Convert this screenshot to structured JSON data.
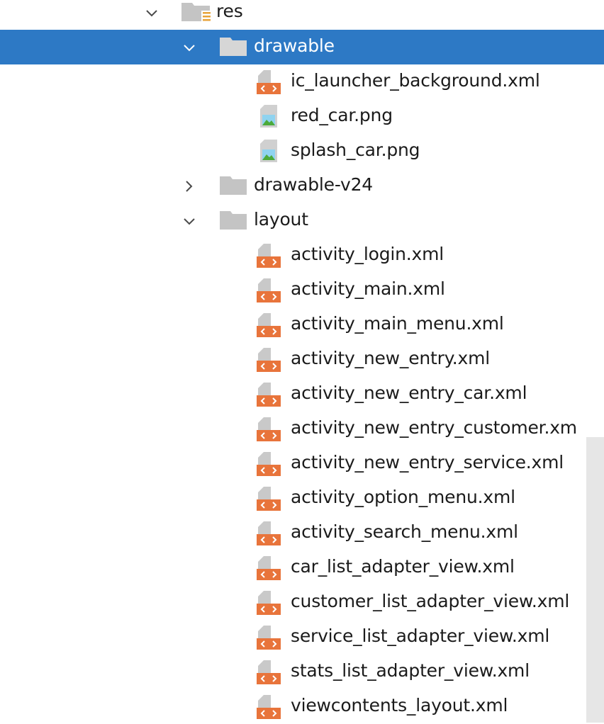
{
  "colors": {
    "selection": "#2d79c5",
    "folder": "#c4c4c4",
    "xml_badge": "#e8743b",
    "image_green": "#4caa3b",
    "image_blue": "#8fd3f0"
  },
  "tree": {
    "res": {
      "label": "res",
      "icon": "resource-folder-icon",
      "expanded": true
    },
    "drawable": {
      "label": "drawable",
      "icon": "folder-icon",
      "expanded": true,
      "selected": true
    },
    "drawable_files": [
      {
        "label": "ic_launcher_background.xml",
        "icon": "xml-file-icon"
      },
      {
        "label": "red_car.png",
        "icon": "image-file-icon"
      },
      {
        "label": "splash_car.png",
        "icon": "image-file-icon"
      }
    ],
    "drawable_v24": {
      "label": "drawable-v24",
      "icon": "folder-icon",
      "expanded": false
    },
    "layout": {
      "label": "layout",
      "icon": "folder-icon",
      "expanded": true
    },
    "layout_files": [
      {
        "label": "activity_login.xml",
        "icon": "xml-file-icon"
      },
      {
        "label": "activity_main.xml",
        "icon": "xml-file-icon"
      },
      {
        "label": "activity_main_menu.xml",
        "icon": "xml-file-icon"
      },
      {
        "label": "activity_new_entry.xml",
        "icon": "xml-file-icon"
      },
      {
        "label": "activity_new_entry_car.xml",
        "icon": "xml-file-icon"
      },
      {
        "label": "activity_new_entry_customer.xm",
        "icon": "xml-file-icon"
      },
      {
        "label": "activity_new_entry_service.xml",
        "icon": "xml-file-icon"
      },
      {
        "label": "activity_option_menu.xml",
        "icon": "xml-file-icon"
      },
      {
        "label": "activity_search_menu.xml",
        "icon": "xml-file-icon"
      },
      {
        "label": "car_list_adapter_view.xml",
        "icon": "xml-file-icon"
      },
      {
        "label": "customer_list_adapter_view.xml",
        "icon": "xml-file-icon"
      },
      {
        "label": "service_list_adapter_view.xml",
        "icon": "xml-file-icon"
      },
      {
        "label": "stats_list_adapter_view.xml",
        "icon": "xml-file-icon"
      },
      {
        "label": "viewcontents_layout.xml",
        "icon": "xml-file-icon"
      }
    ]
  }
}
